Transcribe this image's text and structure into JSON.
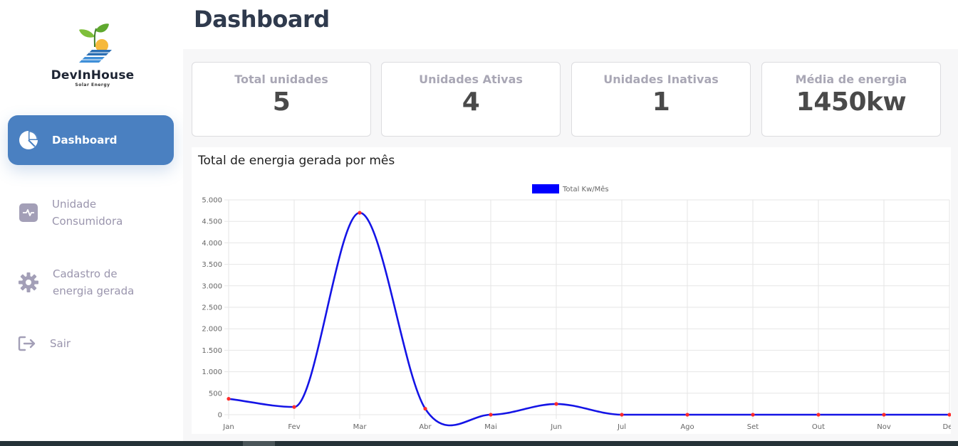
{
  "brand": {
    "name": "DevInHouse",
    "subtitle": "Solar Energy"
  },
  "page_title": "Dashboard",
  "nav": [
    {
      "line1": "Dashboard",
      "line2": "",
      "icon": "pie-chart-icon",
      "active": true
    },
    {
      "line1": "Unidade",
      "line2": "Consumidora",
      "icon": "pulse-icon",
      "active": false
    },
    {
      "line1": "Cadastro de",
      "line2": "energia gerada",
      "icon": "gear-icon",
      "active": false
    },
    {
      "line1": "Sair",
      "line2": "",
      "icon": "logout-icon",
      "active": false
    }
  ],
  "cards": [
    {
      "label": "Total unidades",
      "value": "5"
    },
    {
      "label": "Unidades Ativas",
      "value": "4"
    },
    {
      "label": "Unidades Inativas",
      "value": "1"
    },
    {
      "label": "Média de energia",
      "value": "1450kw"
    }
  ],
  "chart_panel_title": "Total de energia gerada por mês",
  "colors": {
    "accent": "#4a80c1",
    "line": "#1414e6",
    "point": "#ff2b2b"
  },
  "chart_data": {
    "type": "line",
    "categories": [
      "Jan",
      "Fev",
      "Mar",
      "Abr",
      "Mai",
      "Jun",
      "Jul",
      "Ago",
      "Set",
      "Out",
      "Nov",
      "Dez"
    ],
    "series": [
      {
        "name": "Total Kw/Mês",
        "values": [
          370,
          180,
          4700,
          140,
          0,
          250,
          0,
          0,
          0,
          0,
          0,
          0
        ]
      }
    ],
    "ylim": [
      0,
      5000
    ],
    "yticks": [
      "0",
      "500",
      "1.000",
      "1.500",
      "2.000",
      "2.500",
      "3.000",
      "3.500",
      "4.000",
      "4.500",
      "5.000"
    ],
    "grid": true,
    "legend": "top-center",
    "smooth": true
  }
}
